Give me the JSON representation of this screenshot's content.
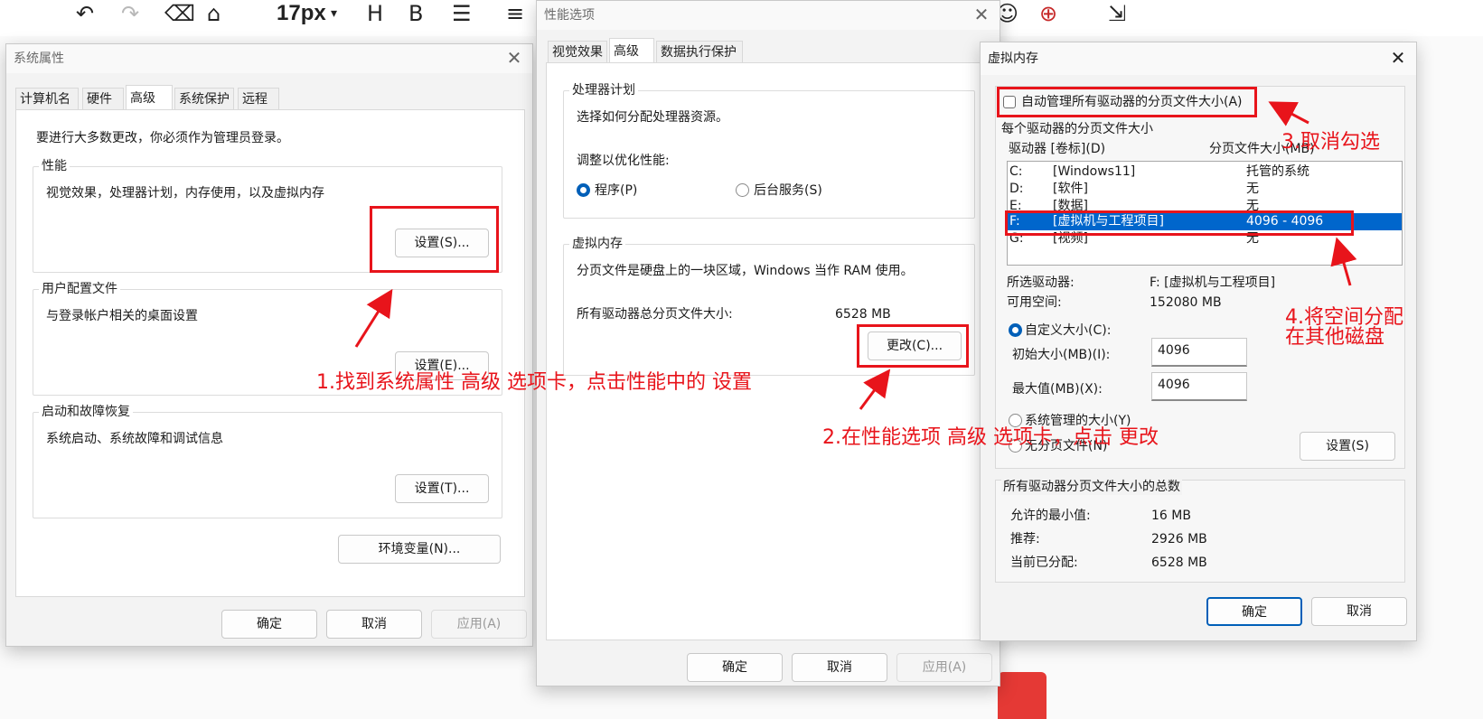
{
  "toolbar": {
    "font_size": "17px",
    "icons": [
      "undo-icon",
      "redo-icon",
      "eraser-icon",
      "format-painter-icon",
      "heading-icon",
      "bold-icon",
      "list-icon",
      "align-icon",
      "emoji-icon",
      "insert-icon",
      "export-icon"
    ]
  },
  "system_properties": {
    "title": "系统属性",
    "tabs": [
      "计算机名",
      "硬件",
      "高级",
      "系统保护",
      "远程"
    ],
    "admin_note": "要进行大多数更改，你必须作为管理员登录。",
    "performance": {
      "title": "性能",
      "desc": "视觉效果，处理器计划，内存使用，以及虚拟内存",
      "button": "设置(S)..."
    },
    "user_profiles": {
      "title": "用户配置文件",
      "desc": "与登录帐户相关的桌面设置",
      "button": "设置(E)..."
    },
    "startup": {
      "title": "启动和故障恢复",
      "desc": "系统启动、系统故障和调试信息",
      "button": "设置(T)..."
    },
    "env_button": "环境变量(N)...",
    "ok": "确定",
    "cancel": "取消",
    "apply": "应用(A)"
  },
  "performance_options": {
    "title": "性能选项",
    "tabs": [
      "视觉效果",
      "高级",
      "数据执行保护"
    ],
    "cpu": {
      "title": "处理器计划",
      "desc": "选择如何分配处理器资源。",
      "adjust_label": "调整以优化性能:",
      "opt_programs": "程序(P)",
      "opt_services": "后台服务(S)"
    },
    "vm": {
      "title": "虚拟内存",
      "desc": "分页文件是硬盘上的一块区域，Windows 当作 RAM 使用。",
      "total_label": "所有驱动器总分页文件大小:",
      "total_value": "6528 MB",
      "change_button": "更改(C)..."
    },
    "ok": "确定",
    "cancel": "取消",
    "apply": "应用(A)"
  },
  "virtual_memory": {
    "title": "虚拟内存",
    "auto_manage": "自动管理所有驱动器的分页文件大小(A)",
    "per_drive_title": "每个驱动器的分页文件大小",
    "col_drive": "驱动器 [卷标](D)",
    "col_size": "分页文件大小(MB)",
    "drives": [
      {
        "letter": "C:",
        "label": "[Windows11]",
        "size": "托管的系统"
      },
      {
        "letter": "D:",
        "label": "[软件]",
        "size": "无"
      },
      {
        "letter": "E:",
        "label": "[数据]",
        "size": "无"
      },
      {
        "letter": "F:",
        "label": "[虚拟机与工程项目]",
        "size": "4096 - 4096"
      },
      {
        "letter": "G:",
        "label": "[视频]",
        "size": "无"
      }
    ],
    "selected_drive_label": "所选驱动器:",
    "selected_drive_value": "F:  [虚拟机与工程项目]",
    "free_space_label": "可用空间:",
    "free_space_value": "152080 MB",
    "custom_size": "自定义大小(C):",
    "initial_label": "初始大小(MB)(I):",
    "initial_value": "4096",
    "max_label": "最大值(MB)(X):",
    "max_value": "4096",
    "system_managed": "系统管理的大小(Y)",
    "no_paging": "无分页文件(N)",
    "set_button": "设置(S)",
    "total_title": "所有驱动器分页文件大小的总数",
    "min_label": "允许的最小值:",
    "min_value": "16 MB",
    "rec_label": "推荐:",
    "rec_value": "2926 MB",
    "cur_label": "当前已分配:",
    "cur_value": "6528 MB",
    "ok": "确定",
    "cancel": "取消"
  },
  "annotations": {
    "step1": "1.找到系统属性 高级 选项卡，点击性能中的 设置",
    "step2": "2.在性能选项 高级 选项卡，点击 更改",
    "step3": "3.取消勾选",
    "step4_line1": "4.将空间分配",
    "step4_line2": "在其他磁盘"
  },
  "colors": {
    "annotation_red": "#e8141b",
    "selection_blue": "#0066cc",
    "accent": "#005fb8"
  }
}
